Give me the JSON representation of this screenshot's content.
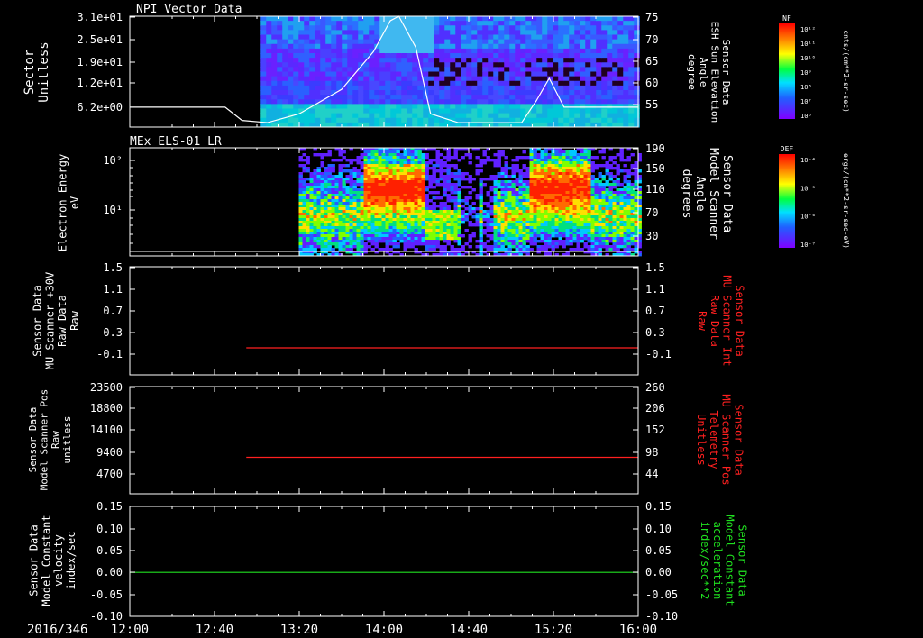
{
  "footer": {
    "date_label": "2016/346"
  },
  "time_axis": {
    "labels": [
      "12:00",
      "12:40",
      "13:20",
      "14:00",
      "14:40",
      "15:20",
      "16:00"
    ]
  },
  "colors": {
    "background": "#000000",
    "axis": "#ffffff",
    "red_trace": "#ff2020",
    "green_trace": "#20e020"
  },
  "colorbars": [
    {
      "top_label": "NF",
      "right_label": "cnts/(cm**2-sr-sec)",
      "ticks": [
        "10¹²",
        "10¹¹",
        "10¹⁰",
        "10⁹",
        "10⁸",
        "10⁷",
        "10⁶"
      ]
    },
    {
      "top_label": "DEF",
      "right_label": "ergs/(cm**2-sr-sec-eV)",
      "ticks": [
        "10⁻⁴",
        "10⁻⁵",
        "10⁻⁶",
        "10⁻⁷"
      ]
    }
  ],
  "chart_data": [
    {
      "type": "heatmap",
      "title": "NPI Vector Data",
      "ylabel": "Sector\nUnitless",
      "y_ticks": [
        "3.1e+01",
        "2.5e+01",
        "1.9e+01",
        "1.2e+01",
        "6.2e+00"
      ],
      "y2label": "Sensor Data\nESH Sun Elevation\nAngle\ndegree",
      "y2_ticks": [
        "75",
        "70",
        "65",
        "60",
        "55"
      ],
      "y2lim": [
        50,
        75
      ],
      "overlay_series": {
        "name": "Sun Elevation Angle",
        "color": "#ffffff",
        "x": [
          "12:00",
          "12:45",
          "12:53",
          "13:05",
          "13:20",
          "13:40",
          "13:55",
          "14:03",
          "14:07",
          "14:15",
          "14:22",
          "14:35",
          "15:05",
          "15:12",
          "15:18",
          "15:25",
          "16:00"
        ],
        "values": [
          54.5,
          54.5,
          51.5,
          51,
          53,
          58.5,
          67,
          74,
          75,
          68,
          53,
          51,
          51,
          56,
          61,
          54.5,
          54.5
        ]
      }
    },
    {
      "type": "heatmap",
      "title": "MEx ELS-01 LR",
      "ylabel": "Electron Energy\neV",
      "y_ticks": [
        "10²",
        "10¹"
      ],
      "y2label": "Sensor Data\nModel Scanner\nAngle\ndegrees",
      "y2_ticks": [
        "190",
        "150",
        "110",
        "70",
        "30"
      ],
      "y2lim": [
        0,
        190
      ],
      "overlay_series": {
        "name": "Scanner Angle",
        "color": "#ffffff",
        "x": [
          "12:00",
          "16:00"
        ],
        "values": [
          8,
          8
        ]
      }
    },
    {
      "type": "line",
      "ylabel": "Sensor Data\nMU Scanner +30V\nRaw Data\nRaw",
      "y_ticks": [
        "1.5",
        "1.1",
        "0.7",
        "0.3",
        "-0.1"
      ],
      "y2label": "Sensor Data\nMU Scanner Int\nRaw Data\nRaw",
      "y2_ticks": [
        "1.5",
        "1.1",
        "0.7",
        "0.3",
        "-0.1"
      ],
      "ylim": [
        -0.5,
        1.5
      ],
      "series": [
        {
          "color": "#ff2020",
          "x": [
            "12:55",
            "16:00"
          ],
          "values": [
            0.0,
            0.0
          ]
        }
      ]
    },
    {
      "type": "line",
      "ylabel": "Sensor Data\nModel Scanner Pos\nRaw\nunitless",
      "y_ticks": [
        "23500",
        "18800",
        "14100",
        "9400",
        "4700"
      ],
      "y2label": "Sensor Data\nMU Scanner Pos\nTelemetry\nUnitless",
      "y2_ticks": [
        "260",
        "206",
        "152",
        "98",
        "44"
      ],
      "ylim": [
        0,
        23500
      ],
      "series": [
        {
          "color": "#ff2020",
          "x": [
            "12:55",
            "16:00"
          ],
          "values": [
            8000,
            8000
          ]
        }
      ]
    },
    {
      "type": "line",
      "ylabel": "Sensor Data\nModel Constant\nvelocity\nindex/sec",
      "y_ticks": [
        "0.15",
        "0.10",
        "0.05",
        "0.00",
        "-0.05",
        "-0.10"
      ],
      "y2label": "Sensor Data\nModel Constant\nacceleration\nindex/sec**2",
      "y2_ticks": [
        "0.15",
        "0.10",
        "0.05",
        "0.00",
        "-0.05",
        "-0.10"
      ],
      "ylim": [
        -0.1,
        0.15
      ],
      "series": [
        {
          "color": "#20e020",
          "x": [
            "12:00",
            "16:00"
          ],
          "values": [
            0.0,
            0.0
          ]
        }
      ]
    }
  ]
}
